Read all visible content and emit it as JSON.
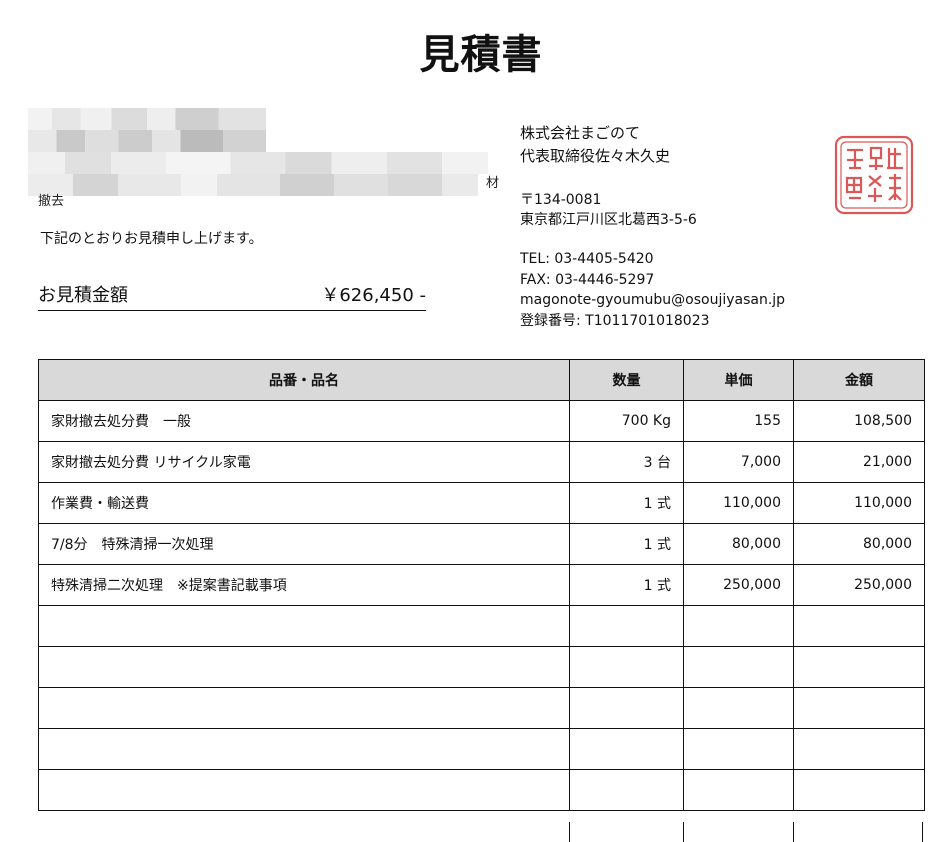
{
  "document": {
    "title": "見積書"
  },
  "recipient": {
    "left_fragment": "撤去",
    "right_fragment": "材"
  },
  "intro_text": "下記のとおりお見積申し上げます。",
  "total": {
    "label": "お見積金額",
    "amount": "￥626,450 -"
  },
  "company": {
    "name": "株式会社まごのて",
    "representative": "代表取締役佐々木久史",
    "postal": "〒134-0081",
    "address": "東京都江戸川区北葛西3-5-6",
    "tel": "TEL: 03-4405-5420",
    "fax": "FAX: 03-4446-5297",
    "email": "magonote-gyoumubu@osoujiyasan.jp",
    "registration": "登録番号: T1011701018023",
    "seal_color": "#d43b3b"
  },
  "table": {
    "headers": [
      "品番・品名",
      "数量",
      "単価",
      "金額"
    ],
    "rows": [
      {
        "name": "家財撤去処分費　一般",
        "qty": "700 Kg",
        "unit": "155",
        "amount": "108,500"
      },
      {
        "name": "家財撤去処分費 リサイクル家電",
        "qty": "3 台",
        "unit": "7,000",
        "amount": "21,000"
      },
      {
        "name": "作業費・輸送費",
        "qty": "1 式",
        "unit": "110,000",
        "amount": "110,000"
      },
      {
        "name": "7/8分　特殊清掃一次処理",
        "qty": "1 式",
        "unit": "80,000",
        "amount": "80,000"
      },
      {
        "name": "特殊清掃二次処理　※提案書記載事項",
        "qty": "1 式",
        "unit": "250,000",
        "amount": "250,000"
      },
      {
        "name": "",
        "qty": "",
        "unit": "",
        "amount": ""
      },
      {
        "name": "",
        "qty": "",
        "unit": "",
        "amount": ""
      },
      {
        "name": "",
        "qty": "",
        "unit": "",
        "amount": ""
      },
      {
        "name": "",
        "qty": "",
        "unit": "",
        "amount": ""
      },
      {
        "name": "",
        "qty": "",
        "unit": "",
        "amount": ""
      }
    ]
  }
}
